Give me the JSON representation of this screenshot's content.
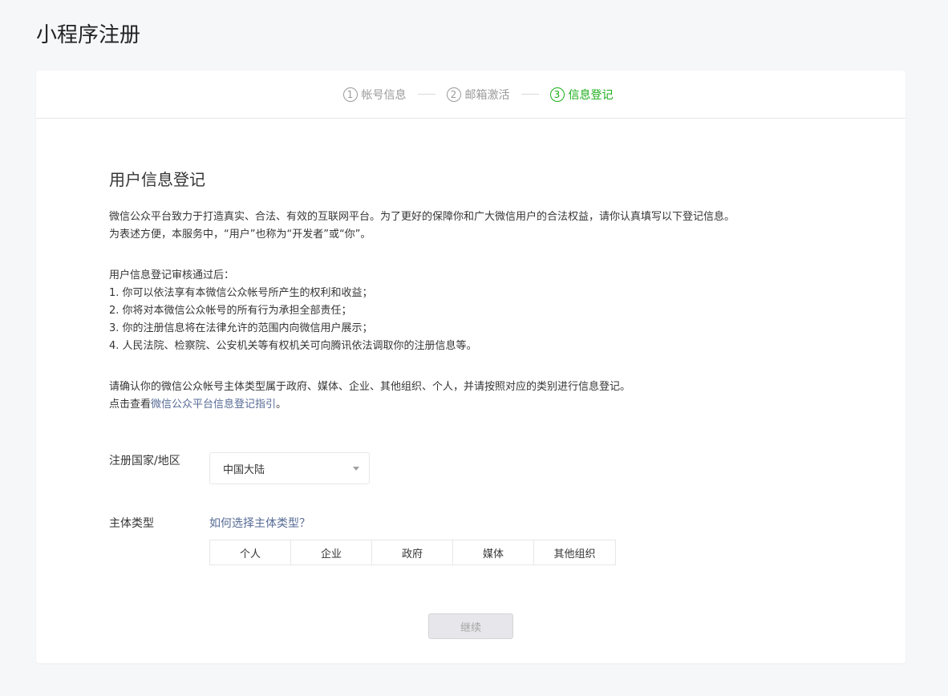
{
  "page": {
    "title": "小程序注册"
  },
  "steps": [
    {
      "num": "1",
      "label": "帐号信息"
    },
    {
      "num": "2",
      "label": "邮箱激活"
    },
    {
      "num": "3",
      "label": "信息登记"
    }
  ],
  "section": {
    "title": "用户信息登记",
    "intro_line1": "微信公众平台致力于打造真实、合法、有效的互联网平台。为了更好的保障你和广大微信用户的合法权益，请你认真填写以下登记信息。",
    "intro_line2": "为表述方便，本服务中，“用户”也称为“开发者”或“你”。",
    "after_title": "用户信息登记审核通过后：",
    "after_items": [
      "1. 你可以依法享有本微信公众帐号所产生的权利和收益；",
      "2. 你将对本微信公众帐号的所有行为承担全部责任；",
      "3. 你的注册信息将在法律允许的范围内向微信用户展示；",
      "4. 人民法院、检察院、公安机关等有权机关可向腾讯依法调取你的注册信息等。"
    ],
    "confirm_line": "请确认你的微信公众帐号主体类型属于政府、媒体、企业、其他组织、个人，并请按照对应的类别进行信息登记。",
    "guide_prefix": "点击查看",
    "guide_link": "微信公众平台信息登记指引",
    "guide_suffix": "。"
  },
  "form": {
    "country_label": "注册国家/地区",
    "country_value": "中国大陆",
    "type_label": "主体类型",
    "type_help_link": "如何选择主体类型？",
    "type_options": [
      "个人",
      "企业",
      "政府",
      "媒体",
      "其他组织"
    ]
  },
  "actions": {
    "continue_label": "继续"
  },
  "colors": {
    "accent": "#1aad19",
    "link": "#576b95",
    "muted": "#9a9a9a"
  }
}
